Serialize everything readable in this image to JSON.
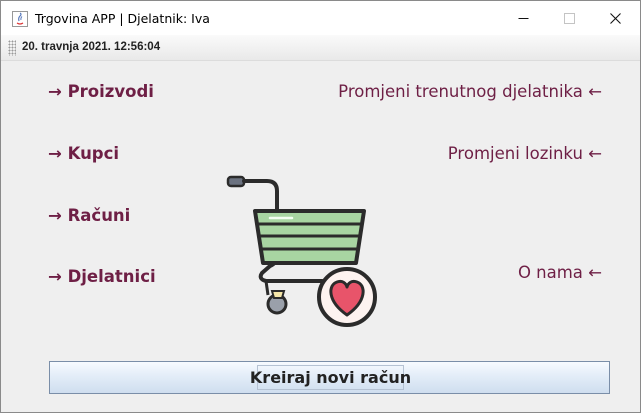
{
  "window": {
    "title": "Trgovina APP | Djelatnik: Iva",
    "app_icon": "java-app-icon",
    "controls": [
      "minimize-icon",
      "maximize-icon",
      "close-icon"
    ]
  },
  "statusbar": {
    "datetime": "20. travnja 2021. 12:56:04"
  },
  "nav_left": [
    {
      "label": "→ Proizvodi"
    },
    {
      "label": "→ Kupci"
    },
    {
      "label": "→ Računi"
    },
    {
      "label": "→ Djelatnici"
    }
  ],
  "nav_right": [
    {
      "label": "Promjeni trenutnog djelatnika ←"
    },
    {
      "label": "Promjeni lozinku ←"
    },
    {
      "label": "O nama ←"
    }
  ],
  "illustration": "shopping-cart-heart-icon",
  "main_button": {
    "label": "Kreiraj novi račun"
  },
  "colors": {
    "nav_text": "#6e1f45",
    "cart_basket": "#a8d5a2",
    "heart": "#e8546a",
    "button_gradient_top": "#f7fbff",
    "button_gradient_bottom": "#cfdeef"
  }
}
